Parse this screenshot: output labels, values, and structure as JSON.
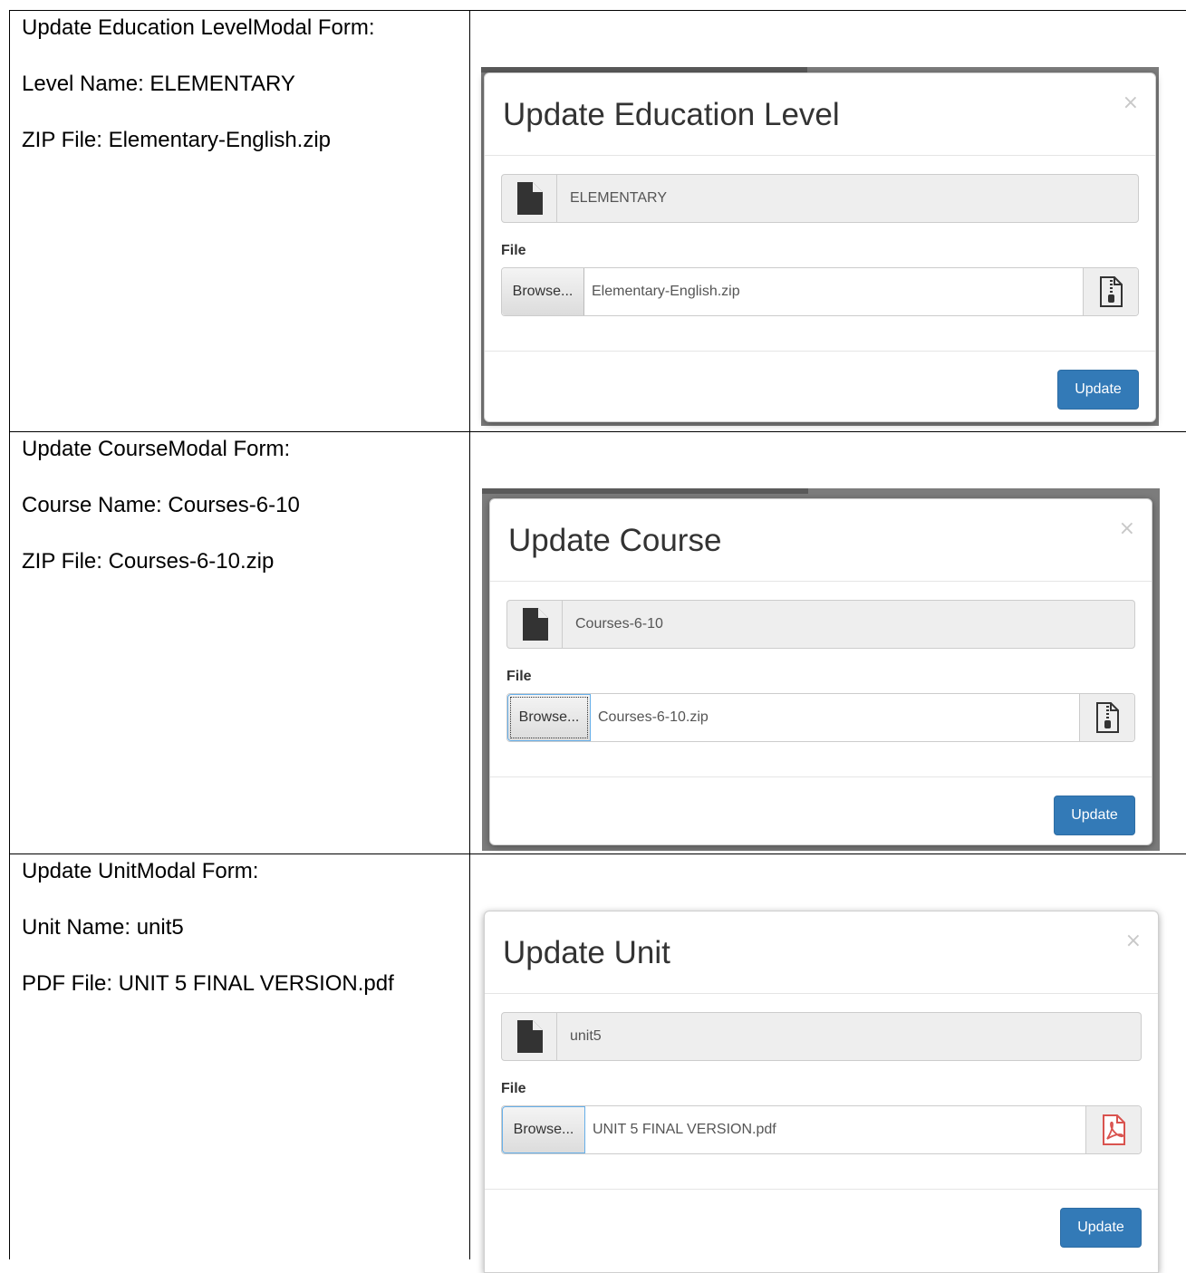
{
  "rows": [
    {
      "desc": {
        "heading": "Update Education LevelModal Form:",
        "name_line": "Level Name: ELEMENTARY",
        "file_line": "ZIP File: Elementary-English.zip"
      },
      "modal": {
        "title": "Update Education Level",
        "close": "×",
        "name_value": "ELEMENTARY",
        "file_label": "File",
        "browse_label": "Browse...",
        "file_value": "Elementary-English.zip",
        "file_type_icon": "zip-file-icon",
        "update_label": "Update"
      }
    },
    {
      "desc": {
        "heading": "Update CourseModal Form:",
        "name_line": "Course Name: Courses-6-10",
        "file_line": "ZIP File: Courses-6-10.zip"
      },
      "modal": {
        "title": "Update Course",
        "close": "×",
        "name_value": "Courses-6-10",
        "file_label": "File",
        "browse_label": "Browse...",
        "file_value": "Courses-6-10.zip",
        "file_type_icon": "zip-file-icon",
        "update_label": "Update"
      }
    },
    {
      "desc": {
        "heading": "Update UnitModal Form:",
        "name_line": "Unit Name: unit5",
        "file_line": "PDF File: UNIT 5 FINAL VERSION.pdf"
      },
      "modal": {
        "title": "Update Unit",
        "close": "×",
        "name_value": "unit5",
        "file_label": "File",
        "browse_label": "Browse...",
        "file_value": "UNIT 5 FINAL VERSION.pdf",
        "file_type_icon": "pdf-file-icon",
        "update_label": "Update"
      }
    }
  ],
  "colors": {
    "primary": "#337ab7",
    "pdf_red": "#d9534f"
  }
}
